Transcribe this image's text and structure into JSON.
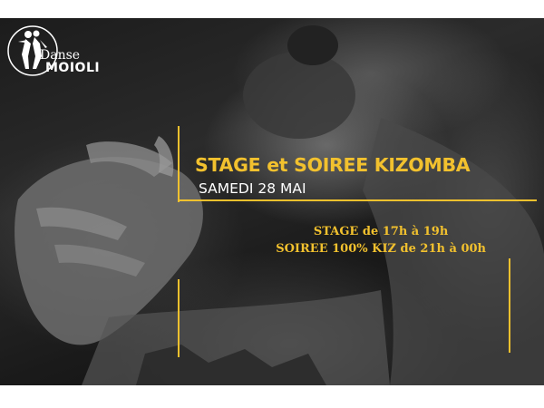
{
  "logo": {
    "line1": "Danse",
    "line2": "MOIOLI",
    "icon": "dancing-couple-logo-icon"
  },
  "event": {
    "title": "STAGE et SOIREE KIZOMBA",
    "date": "SAMEDI 28 MAI",
    "schedule": [
      "STAGE de 17h à 19h",
      "SOIREE 100% KIZ de 21h à 00h"
    ]
  },
  "colors": {
    "accent": "#f2c12e",
    "text_light": "#ffffff",
    "background": "#1a1a1a"
  }
}
